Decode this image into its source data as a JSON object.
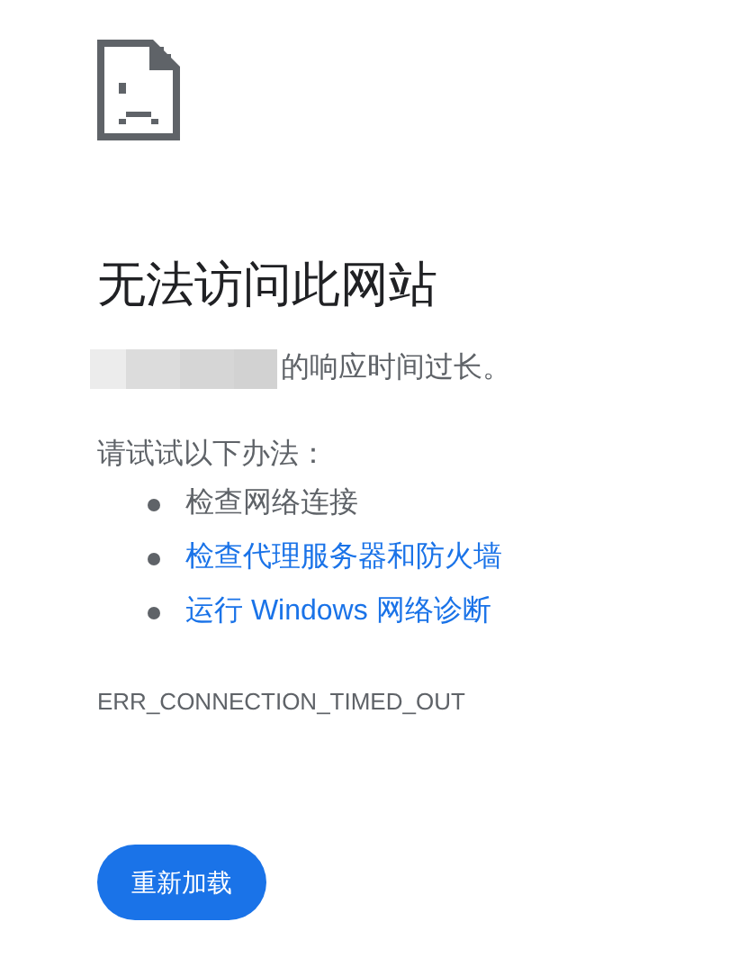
{
  "heading": "无法访问此网站",
  "summary": "的响应时间过长。",
  "suggestions_title": "请试试以下办法：",
  "suggestions": [
    {
      "kind": "text",
      "label": "检查网络连接"
    },
    {
      "kind": "link",
      "label": "检查代理服务器和防火墙"
    },
    {
      "kind": "link",
      "label": "运行 Windows 网络诊断"
    }
  ],
  "error_code": "ERR_CONNECTION_TIMED_OUT",
  "reload_button": "重新加载"
}
